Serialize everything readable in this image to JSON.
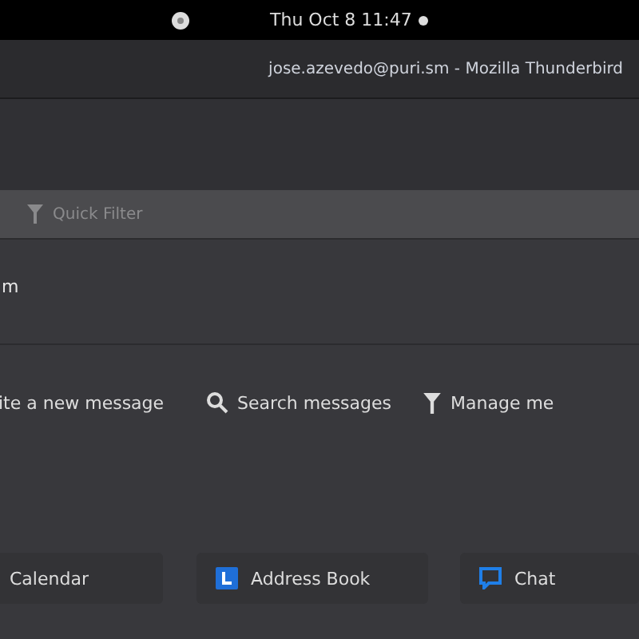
{
  "top_bar": {
    "clock": "Thu Oct 8  11:47"
  },
  "window": {
    "title": "jose.azevedo@puri.sm - Mozilla Thunderbird"
  },
  "quick_filter": {
    "placeholder": "Quick Filter"
  },
  "account_name": "m",
  "actions": [
    {
      "kind": "write",
      "label": "ite a new message"
    },
    {
      "kind": "search",
      "label": "Search messages"
    },
    {
      "kind": "filter",
      "label": "Manage me"
    }
  ],
  "bottom_buttons": [
    {
      "kind": "calendar",
      "label": "Calendar"
    },
    {
      "kind": "addressbook",
      "label": "Address Book"
    },
    {
      "kind": "chat",
      "label": "Chat"
    }
  ]
}
